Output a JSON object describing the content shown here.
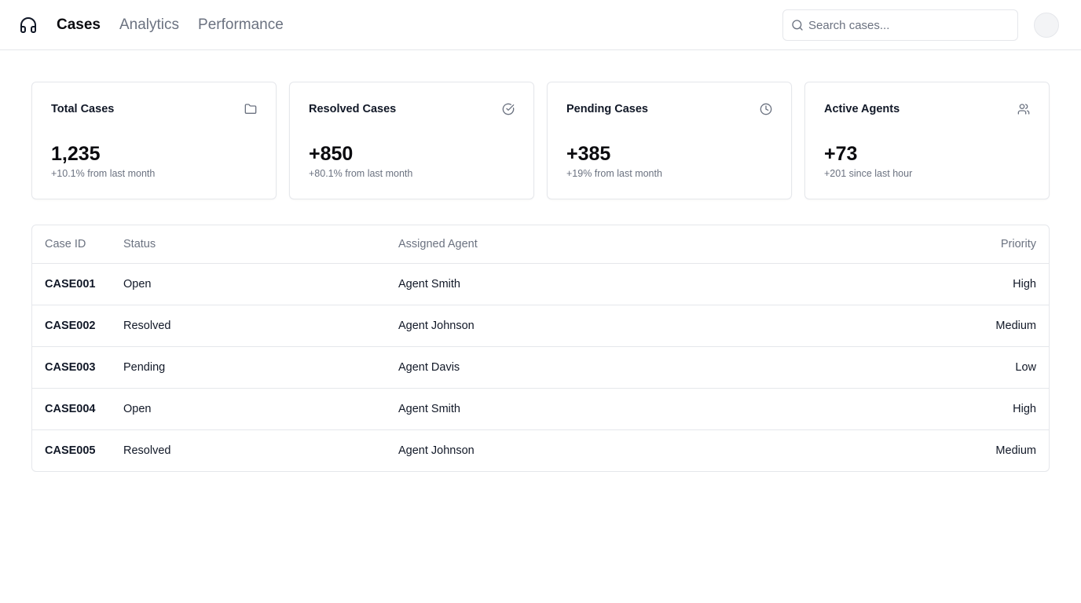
{
  "header": {
    "logo_icon": "headphones-icon",
    "nav": [
      {
        "label": "Cases",
        "active": true
      },
      {
        "label": "Analytics",
        "active": false
      },
      {
        "label": "Performance",
        "active": false
      }
    ],
    "search": {
      "placeholder": "Search cases...",
      "value": "",
      "icon": "search-icon"
    },
    "avatar_icon": "user-avatar"
  },
  "stats": [
    {
      "title": "Total Cases",
      "value": "1,235",
      "sub": "+10.1% from last month",
      "icon": "folder-icon"
    },
    {
      "title": "Resolved Cases",
      "value": "+850",
      "sub": "+80.1% from last month",
      "icon": "check-circle-icon"
    },
    {
      "title": "Pending Cases",
      "value": "+385",
      "sub": "+19% from last month",
      "icon": "clock-icon"
    },
    {
      "title": "Active Agents",
      "value": "+73",
      "sub": "+201 since last hour",
      "icon": "users-icon"
    }
  ],
  "table": {
    "columns": [
      "Case ID",
      "Status",
      "Assigned Agent",
      "Priority"
    ],
    "rows": [
      [
        "CASE001",
        "Open",
        "Agent Smith",
        "High"
      ],
      [
        "CASE002",
        "Resolved",
        "Agent Johnson",
        "Medium"
      ],
      [
        "CASE003",
        "Pending",
        "Agent Davis",
        "Low"
      ],
      [
        "CASE004",
        "Open",
        "Agent Smith",
        "High"
      ],
      [
        "CASE005",
        "Resolved",
        "Agent Johnson",
        "Medium"
      ]
    ]
  },
  "colors": {
    "accent_text": "#0b0b0f",
    "muted_text": "#6b7280",
    "border": "#e5e7eb"
  }
}
